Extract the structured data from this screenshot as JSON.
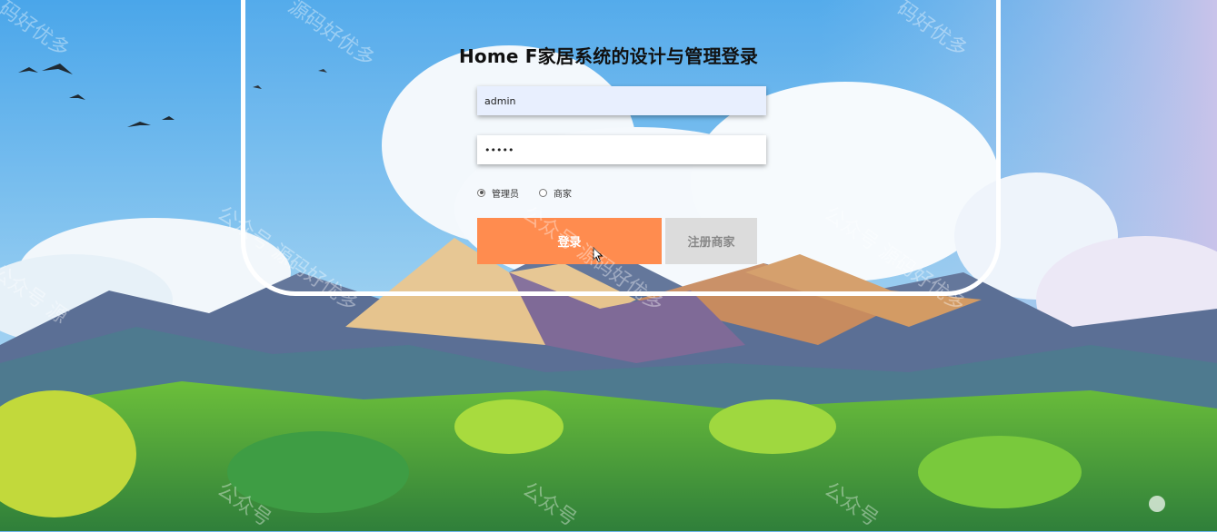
{
  "login": {
    "title": "Home F家居系统的设计与管理登录",
    "username": {
      "value": "admin"
    },
    "password": {
      "value": "•••••"
    },
    "roles": [
      {
        "label": "管理员",
        "checked": true
      },
      {
        "label": "商家",
        "checked": false
      }
    ],
    "login_label": "登录",
    "register_label": "注册商家"
  },
  "watermark": {
    "text": "公众号 源码好优多",
    "fragments": [
      "码好优多",
      "源码好优多",
      "码好优多",
      "公众号 源",
      "公众号 源码好优多",
      "公众号 源码好优多",
      "公众号 源码好优多",
      "公众号",
      "公众号",
      "公众号"
    ]
  },
  "colors": {
    "login_button": "#ff8c4f",
    "register_button": "#dcdcdc",
    "username_bg": "#e8effe"
  }
}
